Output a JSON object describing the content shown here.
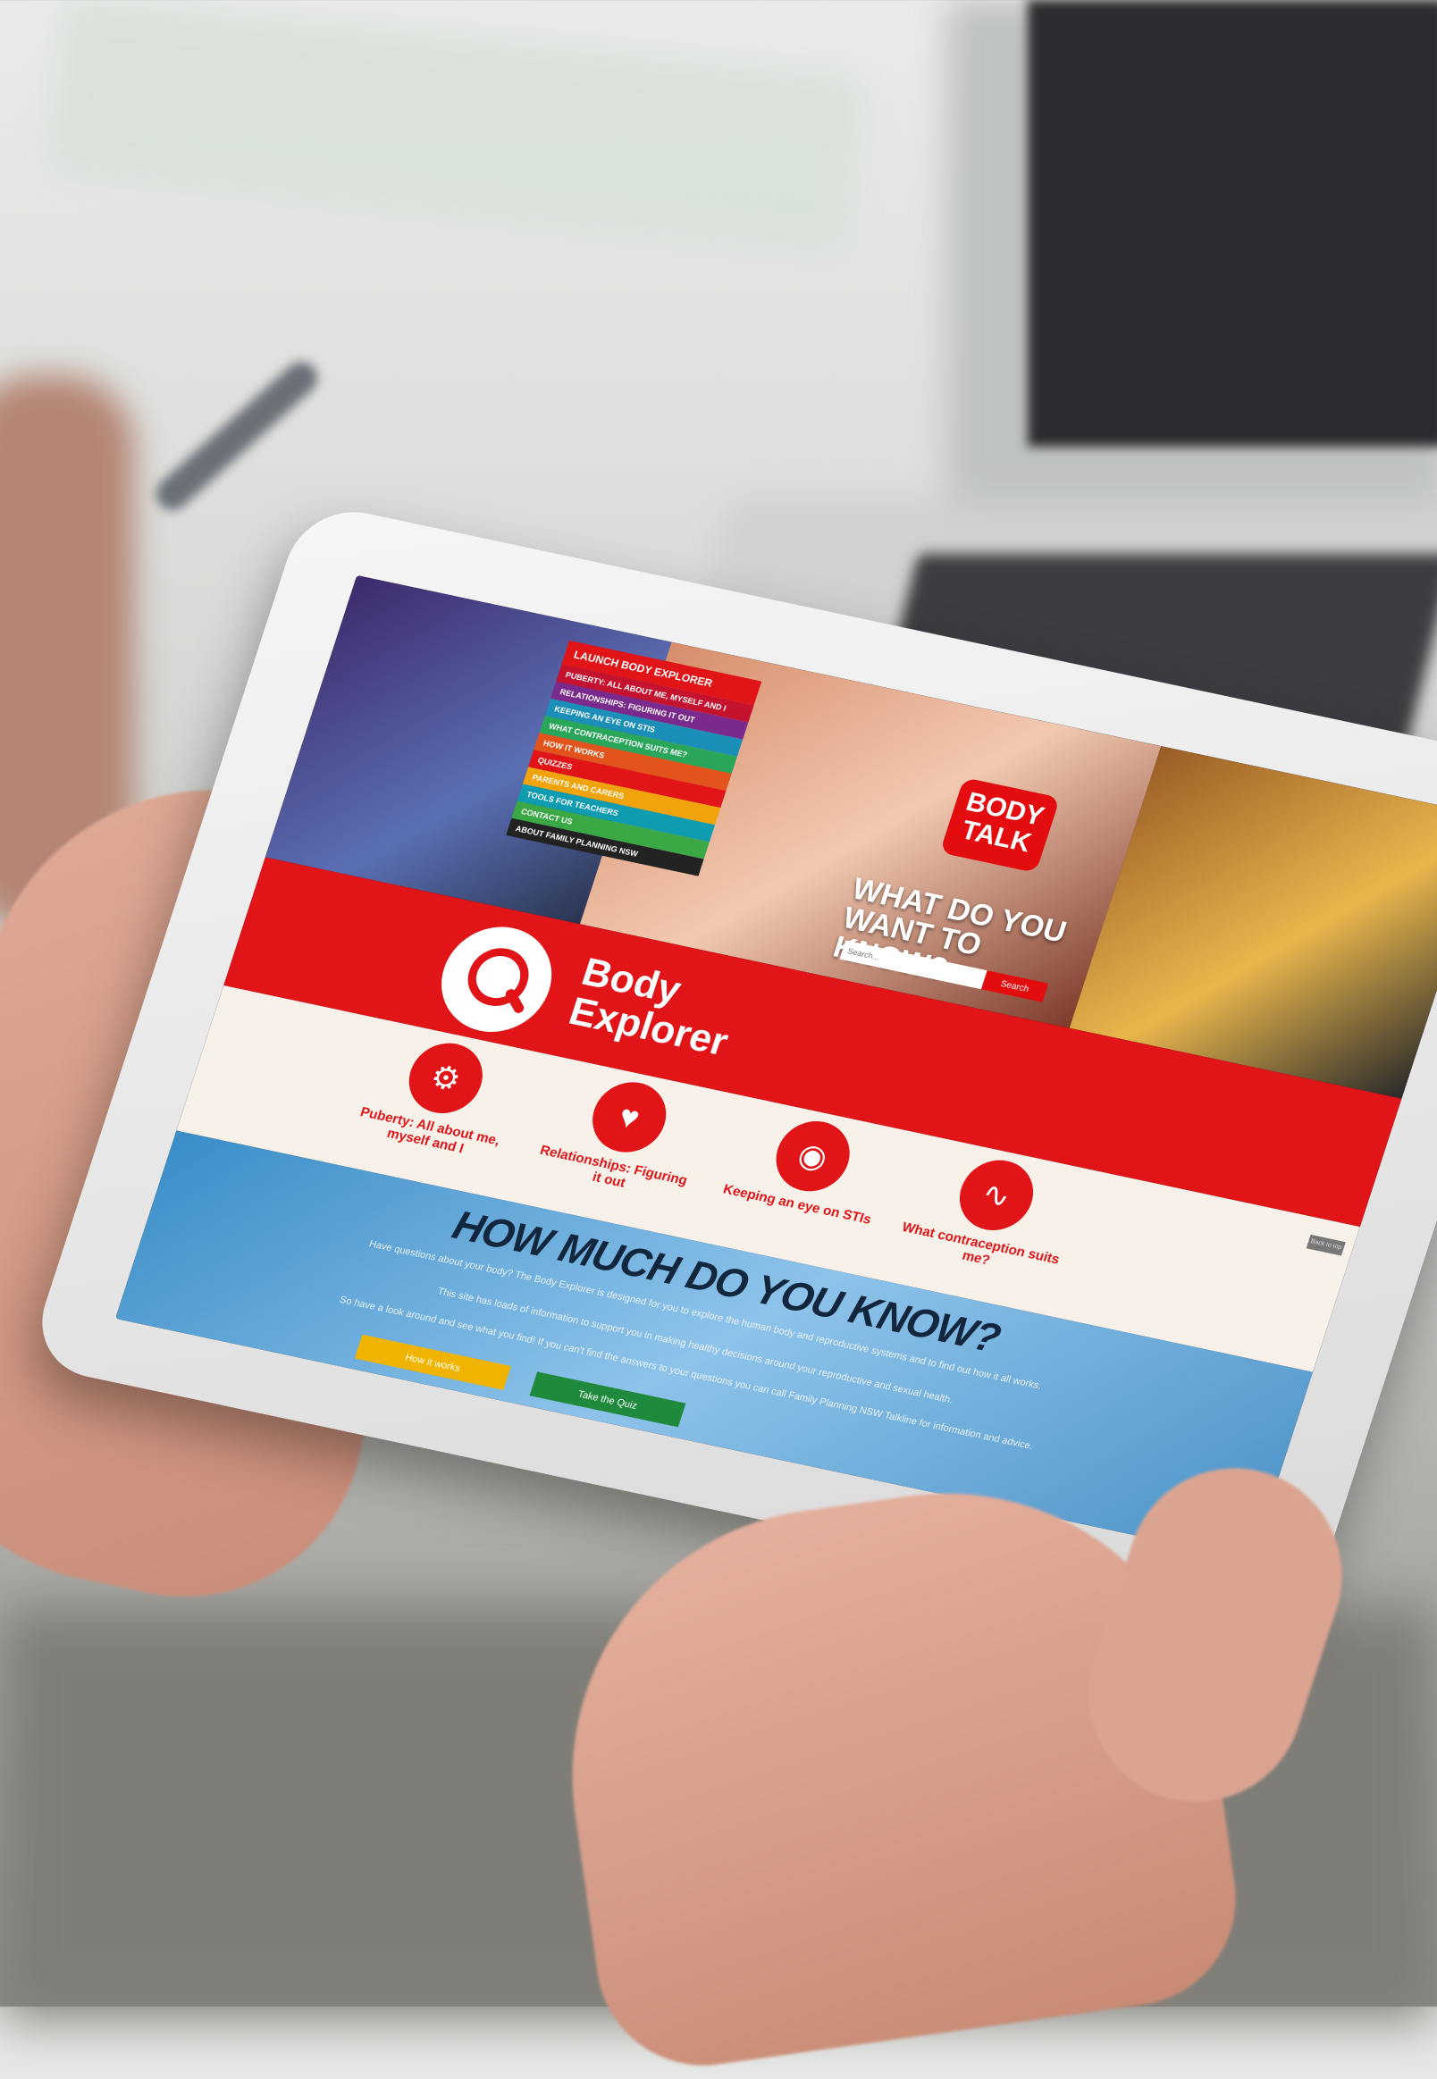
{
  "menu": {
    "launch": "LAUNCH BODY EXPLORER",
    "items": [
      {
        "label": "PUBERTY: ALL ABOUT ME, MYSELF AND I",
        "color": "#c4122f"
      },
      {
        "label": "RELATIONSHIPS: FIGURING IT OUT",
        "color": "#7a2a8c"
      },
      {
        "label": "KEEPING AN EYE ON STIS",
        "color": "#1c8fb8"
      },
      {
        "label": "WHAT CONTRACEPTION SUITS ME?",
        "color": "#2aa65a"
      },
      {
        "label": "HOW IT WORKS",
        "color": "#e2541b"
      },
      {
        "label": "QUIZZES",
        "color": "#e11417"
      },
      {
        "label": "PARENTS AND CARERS",
        "color": "#f0a30a"
      },
      {
        "label": "TOOLS FOR TEACHERS",
        "color": "#0f9bb0"
      },
      {
        "label": "CONTACT US",
        "color": "#39a845"
      },
      {
        "label": "ABOUT FAMILY PLANNING NSW",
        "color": "#222222"
      }
    ]
  },
  "logo": {
    "line1": "BODY",
    "line2": "TALK"
  },
  "hero": {
    "question": "WHAT DO YOU WANT TO KNOW?",
    "search_placeholder": "Search...",
    "search_button": "Search"
  },
  "explorer": {
    "line1": "Body",
    "line2": "Explorer"
  },
  "topics": [
    {
      "label": "Puberty: All about me, myself and I",
      "icon": "head-gears-icon"
    },
    {
      "label": "Relationships: Figuring it out",
      "icon": "heart-hands-icon"
    },
    {
      "label": "Keeping an eye on STIs",
      "icon": "eye-icon"
    },
    {
      "label": "What contraception suits me?",
      "icon": "sperm-icon"
    }
  ],
  "top_tag": "Back to top",
  "quiz": {
    "title": "HOW MUCH DO YOU KNOW?",
    "p1": "Have questions about your body? The Body Explorer is designed for you to explore the human body and reproductive systems and to find out how it all works.",
    "p2": "This site has loads of information to support you in making healthy decisions around your reproductive and sexual health.",
    "p3": "So have a look around and see what you find! If you can't find the answers to your questions you can call Family Planning NSW Talkline for information and advice.",
    "btn_how": "How it works",
    "btn_quiz": "Take the Quiz"
  }
}
